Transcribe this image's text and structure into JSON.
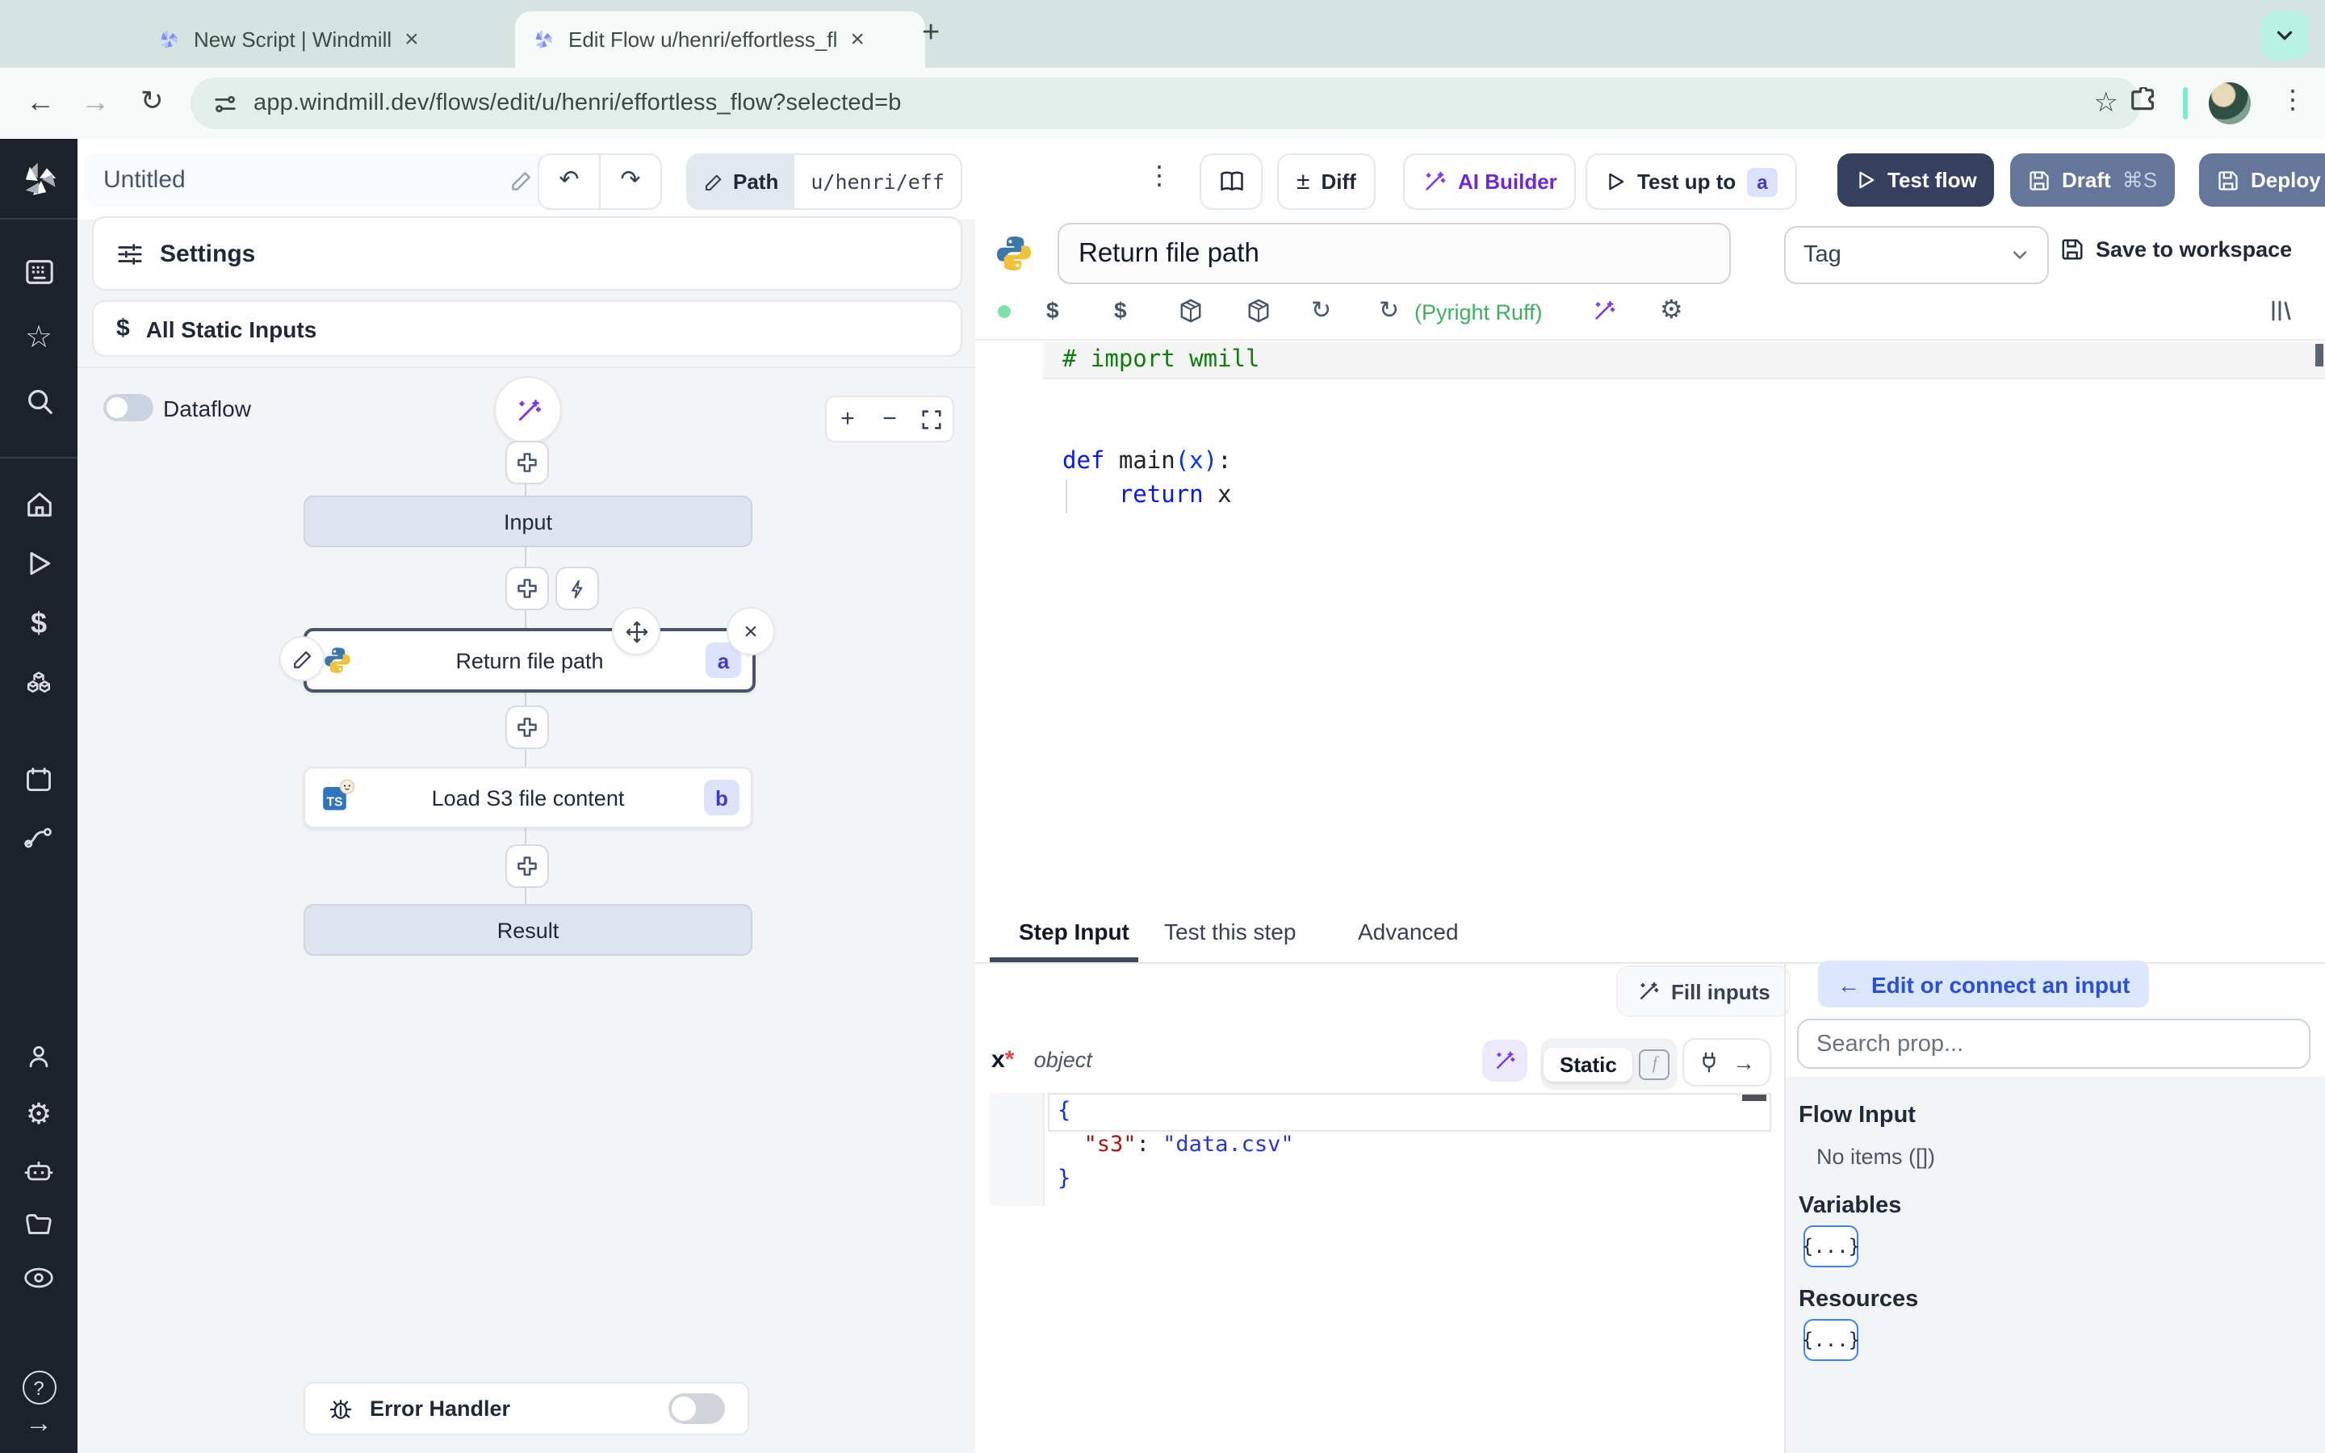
{
  "colors": {
    "accent_navy": "#35415f",
    "slate_button": "#64779b",
    "violet": "#7c3aed",
    "badge_bg": "#dbe3fc",
    "badge_text": "#4338ca",
    "lint_green": "#3fae63",
    "chrome_bg": "#d5e4e0"
  },
  "browser": {
    "tab1": "New Script | Windmill",
    "tab2": "Edit Flow u/henri/effortless_fl",
    "url": "app.windmill.dev/flows/edit/u/henri/effortless_flow?selected=b"
  },
  "icons": {
    "back": "←",
    "forward": "→",
    "reload": "↻",
    "close": "×",
    "new_tab": "+",
    "kebab": "⋮",
    "undo": "↶",
    "redo": "↷",
    "diff": "±",
    "star": "☆",
    "dollar": "$",
    "gear": "⚙",
    "zoom_in": "+",
    "zoom_out": "−",
    "fn": "f",
    "question": "?",
    "arrow_right": "→",
    "arrow_left": "←"
  },
  "toolbar": {
    "title": "Untitled",
    "path_label": "Path",
    "path_value": "u/henri/eff",
    "diff": "Diff",
    "ai_builder": "AI Builder",
    "test_up_to": "Test up to",
    "test_up_to_badge": "a",
    "test_flow": "Test flow",
    "draft": "Draft",
    "draft_shortcut": "⌘S",
    "deploy": "Deploy"
  },
  "flow": {
    "settings": "Settings",
    "all_static_inputs": "All Static Inputs",
    "dataflow": "Dataflow",
    "input_node": "Input",
    "step_a": "Return file path",
    "badge_a": "a",
    "step_b": "Load S3 file content",
    "step_b_lang": "TS",
    "badge_b": "b",
    "result_node": "Result",
    "error_handler": "Error Handler"
  },
  "editor": {
    "step_name": "Return file path",
    "tag": "Tag",
    "save_to_workspace": "Save to workspace",
    "lint": "(Pyright Ruff)",
    "code": {
      "comment": "# import wmill",
      "kw_def": "def",
      "fn": "main",
      "params": "(x)",
      "colon": ":",
      "indent": "    ",
      "kw_return": "return",
      "arg": "x"
    }
  },
  "panel": {
    "tabs": [
      "Step Input",
      "Test this step",
      "Advanced"
    ],
    "fill_inputs": "Fill inputs",
    "prop": "x",
    "required": "*",
    "type": "object",
    "static": "Static",
    "json": {
      "open": "{",
      "key": "\"s3\"",
      "colon": ": ",
      "value": "\"data.csv\"",
      "close": "}"
    }
  },
  "connect": {
    "edit_connect": "Edit or connect an input",
    "search_placeholder": "Search prop...",
    "flow_input": "Flow Input",
    "no_items": "No items ([])",
    "variables": "Variables",
    "resources": "Resources",
    "braces": "{...}"
  }
}
